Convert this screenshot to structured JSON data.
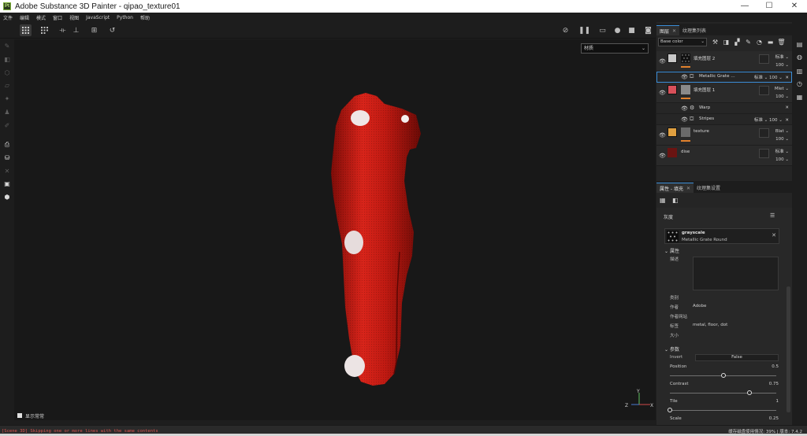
{
  "window": {
    "title": "Adobe Substance 3D Painter - qipao_texture01",
    "logo_text": "Pt",
    "controls": [
      "—",
      "☐",
      "✕"
    ]
  },
  "menu": [
    "文件",
    "编辑",
    "模式",
    "窗口",
    "视图",
    "JavaScript",
    "Python",
    "帮助"
  ],
  "toolbar": {
    "left_icons": [
      "grid-toggle-icon",
      "grid-options-icon",
      "symmetry-icon",
      "symmetry-alt-icon",
      "fit-view-icon",
      "reset-history-icon"
    ],
    "right_icons": [
      "visibility-off-icon",
      "pause-icon",
      "display-mode-icon",
      "sphere-icon",
      "camera-mode-icon",
      "screenshot-icon"
    ]
  },
  "viewport": {
    "material_select": "材质",
    "footer_label": "显示常常",
    "axis_labels": {
      "y": "Y",
      "z": "Z",
      "x": "X"
    },
    "garment_color": "#c0170f"
  },
  "layers_panel": {
    "tabs": [
      {
        "label": "图层"
      },
      {
        "label": "纹理集列表"
      }
    ],
    "channel": "Base color",
    "layers": [
      {
        "name": "填充图层 2",
        "swatch": "#c8c8c8",
        "thumb": "dots",
        "blend": "标准",
        "opacity": "100",
        "kind": "fill"
      },
      {
        "name": "Metallic Grate …",
        "blend": "标准",
        "opacity": "100",
        "kind": "sub",
        "selected": true
      },
      {
        "name": "填充图层 1",
        "swatch": "#d8505a",
        "thumb": "gray",
        "blend": "Mlet",
        "opacity": "100",
        "kind": "fill"
      },
      {
        "name": "Warp",
        "blend": "",
        "opacity": "",
        "kind": "sub"
      },
      {
        "name": "Stripes",
        "blend": "标准",
        "opacity": "100",
        "kind": "sub"
      },
      {
        "name": "texture",
        "swatch": "#e0a040",
        "thumb": "gray",
        "blend": "Blat",
        "opacity": "100",
        "kind": "fill"
      },
      {
        "name": "dise",
        "swatch": "#6a1412",
        "thumb": "dark",
        "blend": "标准",
        "opacity": "100",
        "kind": "fill"
      }
    ]
  },
  "properties_panel": {
    "tabs": [
      {
        "label": "属性 - 填充"
      },
      {
        "label": "纹理集设置"
      }
    ],
    "section_title": "灰度",
    "resource": {
      "name": "grayscale",
      "subtitle": "Metallic Grate Round"
    },
    "attributes_title": "属性",
    "description_label": "描述",
    "fields": [
      {
        "key": "类别",
        "value": ""
      },
      {
        "key": "作者",
        "value": "Adobe"
      },
      {
        "key": "作者网站",
        "value": ""
      },
      {
        "key": "标签",
        "value": "metal, floor, dot"
      },
      {
        "key": "大小",
        "value": ""
      }
    ],
    "params_title": "参数",
    "invert": {
      "label": "Invert",
      "value": "False"
    },
    "params": [
      {
        "label": "Position",
        "value": "0.5",
        "fraction": 0.5
      },
      {
        "label": "Contrast",
        "value": "0.75",
        "fraction": 0.75
      },
      {
        "label": "Tile",
        "value": "1",
        "fraction": 0.0
      },
      {
        "label": "Scale",
        "value": "0.25"
      }
    ]
  },
  "status": {
    "error": "[Scene 3D] Skipping one or more lines with the same contents",
    "right": "缓存磁盘使用情况:    39%  |  版本: 7.4.2"
  }
}
